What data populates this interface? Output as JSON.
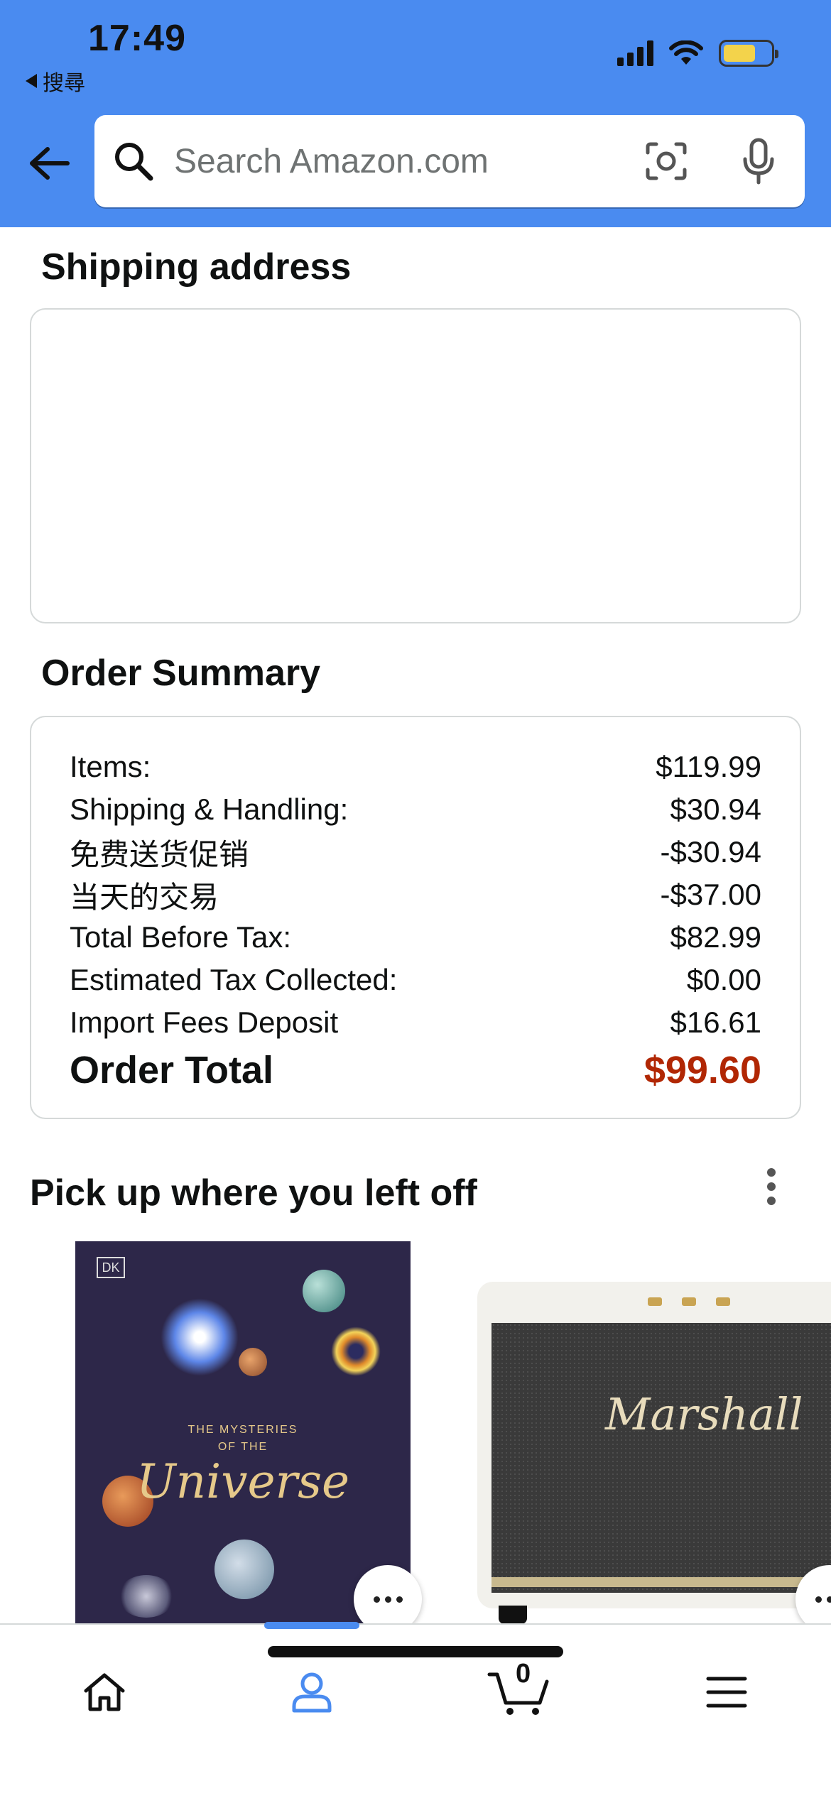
{
  "status_bar": {
    "time": "17:49",
    "back_app_label": "搜尋",
    "icons": [
      "cellular-signal-icon",
      "wifi-icon",
      "battery-icon"
    ]
  },
  "search": {
    "placeholder": "Search Amazon.com",
    "icons": [
      "back-arrow-icon",
      "search-icon",
      "camera-icon",
      "microphone-icon"
    ]
  },
  "shipping": {
    "title": "Shipping address"
  },
  "order_summary": {
    "title": "Order Summary",
    "rows": [
      {
        "label": "Items:",
        "value": "$119.99"
      },
      {
        "label": "Shipping & Handling:",
        "value": "$30.94"
      },
      {
        "label": "免费送货促销",
        "value": "-$30.94"
      },
      {
        "label": "当天的交易",
        "value": "-$37.00"
      },
      {
        "label": "Total Before Tax:",
        "value": "$82.99"
      },
      {
        "label": "Estimated Tax Collected:",
        "value": "$0.00"
      },
      {
        "label": "Import Fees Deposit",
        "value": "$16.61"
      }
    ],
    "total": {
      "label": "Order Total",
      "value": "$99.60"
    },
    "total_color": "#b12704"
  },
  "recent": {
    "title": "Pick up where you left off",
    "items": [
      {
        "cover_badge": "DK",
        "cover_subtitle_line1": "THE MYSTERIES",
        "cover_subtitle_line2": "OF THE",
        "cover_title": "Universe"
      },
      {
        "brand": "Marshall"
      }
    ]
  },
  "tabbar": {
    "tabs": [
      "home-icon",
      "account-icon",
      "cart-icon",
      "menu-icon"
    ],
    "active": "account",
    "cart_count": "0",
    "active_color": "#4a8bf0"
  },
  "theme": {
    "header_color": "#4a8bf0"
  }
}
